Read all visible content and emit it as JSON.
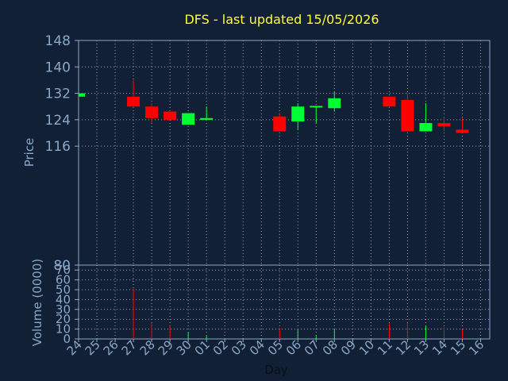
{
  "chart_data": {
    "type": "candlestick",
    "title": "DFS - last updated 15/05/2026",
    "xlabel": "Day",
    "ylabel": "Price",
    "volume_label": "Volume (0000)",
    "x_ticks": [
      "24",
      "25",
      "26",
      "27",
      "28",
      "29",
      "30",
      "01",
      "02",
      "03",
      "04",
      "05",
      "06",
      "07",
      "08",
      "09",
      "10",
      "11",
      "12",
      "13",
      "14",
      "15",
      "16"
    ],
    "price_ylim": [
      80,
      148
    ],
    "price_ticks": [
      80,
      116,
      124,
      132,
      140,
      148
    ],
    "volume_ylim": [
      0,
      75
    ],
    "volume_ticks": [
      0,
      10,
      20,
      30,
      40,
      50,
      60,
      70
    ],
    "grid": true,
    "colors": {
      "up": "#00ff33",
      "down": "#ff0000",
      "background": "#112034",
      "title": "#ffff33",
      "axis_text": "#8aa8c8"
    },
    "candles": [
      {
        "day": "24",
        "open": 131.0,
        "high": 132.0,
        "low": 131.0,
        "close": 132.0,
        "volume": 0
      },
      {
        "day": "27",
        "open": 131.0,
        "high": 136.0,
        "low": 128.0,
        "close": 128.0,
        "volume": 51
      },
      {
        "day": "28",
        "open": 128.0,
        "high": 129.0,
        "low": 123.0,
        "close": 124.5,
        "volume": 16
      },
      {
        "day": "29",
        "open": 126.5,
        "high": 126.5,
        "low": 124.0,
        "close": 124.0,
        "volume": 13
      },
      {
        "day": "30",
        "open": 122.5,
        "high": 126.0,
        "low": 122.5,
        "close": 126.0,
        "volume": 7
      },
      {
        "day": "01",
        "open": 124.0,
        "high": 128.0,
        "low": 124.0,
        "close": 124.5,
        "volume": 3
      },
      {
        "day": "05",
        "open": 125.0,
        "high": 126.0,
        "low": 120.5,
        "close": 120.5,
        "volume": 11
      },
      {
        "day": "06",
        "open": 123.5,
        "high": 129.0,
        "low": 121.0,
        "close": 128.0,
        "volume": 10
      },
      {
        "day": "07",
        "open": 128.0,
        "high": 128.0,
        "low": 123.0,
        "close": 128.2,
        "volume": 3
      },
      {
        "day": "08",
        "open": 127.5,
        "high": 132.5,
        "low": 126.5,
        "close": 130.5,
        "volume": 10
      },
      {
        "day": "11",
        "open": 131.0,
        "high": 131.0,
        "low": 128.0,
        "close": 128.0,
        "volume": 16
      },
      {
        "day": "12",
        "open": 130.0,
        "high": 132.0,
        "low": 120.5,
        "close": 120.5,
        "volume": 16
      },
      {
        "day": "13",
        "open": 120.5,
        "high": 129.0,
        "low": 120.5,
        "close": 123.0,
        "volume": 13
      },
      {
        "day": "14",
        "open": 123.0,
        "high": 125.0,
        "low": 120.5,
        "close": 122.0,
        "volume": 12
      },
      {
        "day": "15",
        "open": 121.0,
        "high": 124.5,
        "low": 120.0,
        "close": 120.0,
        "volume": 10
      }
    ]
  }
}
